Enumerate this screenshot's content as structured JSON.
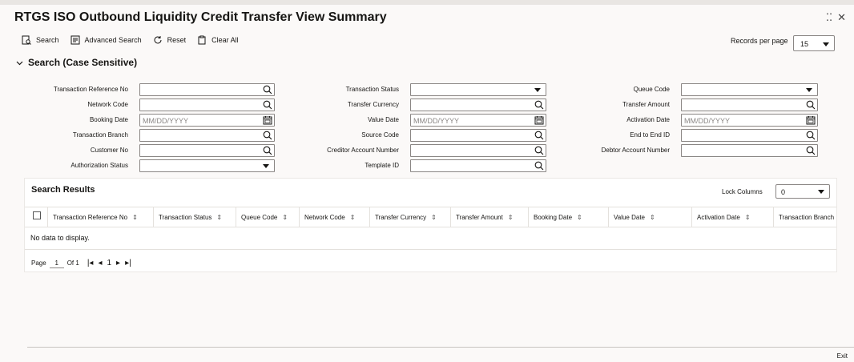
{
  "title": "RTGS ISO Outbound Liquidity Credit Transfer View Summary",
  "toolbar": {
    "search": "Search",
    "advanced_search": "Advanced Search",
    "reset": "Reset",
    "clear_all": "Clear All",
    "records_per_page_label": "Records per page",
    "records_per_page_value": "15"
  },
  "section": {
    "title": "Search (Case Sensitive)"
  },
  "fields": {
    "txn_ref_no": "Transaction Reference No",
    "network_code": "Network Code",
    "booking_date": "Booking Date",
    "txn_branch": "Transaction Branch",
    "customer_no": "Customer No",
    "auth_status": "Authorization Status",
    "txn_status": "Transaction Status",
    "transfer_currency": "Transfer Currency",
    "value_date": "Value Date",
    "source_code": "Source Code",
    "creditor_account": "Creditor Account Number",
    "template_id": "Template ID",
    "queue_code": "Queue Code",
    "transfer_amount": "Transfer Amount",
    "activation_date": "Activation Date",
    "end_to_end_id": "End to End ID",
    "debtor_account": "Debtor Account Number",
    "date_placeholder": "MM/DD/YYYY"
  },
  "results": {
    "title": "Search Results",
    "lock_columns_label": "Lock Columns",
    "lock_columns_value": "0",
    "columns": [
      "Transaction Reference No",
      "Transaction Status",
      "Queue Code",
      "Network Code",
      "Transfer Currency",
      "Transfer Amount",
      "Booking Date",
      "Value Date",
      "Activation Date",
      "Transaction Branch"
    ],
    "no_data": "No data to display.",
    "pager": {
      "page_label": "Page",
      "page": "1",
      "of_label": "Of 1",
      "current": "1"
    }
  },
  "footer": {
    "exit": "Exit"
  }
}
